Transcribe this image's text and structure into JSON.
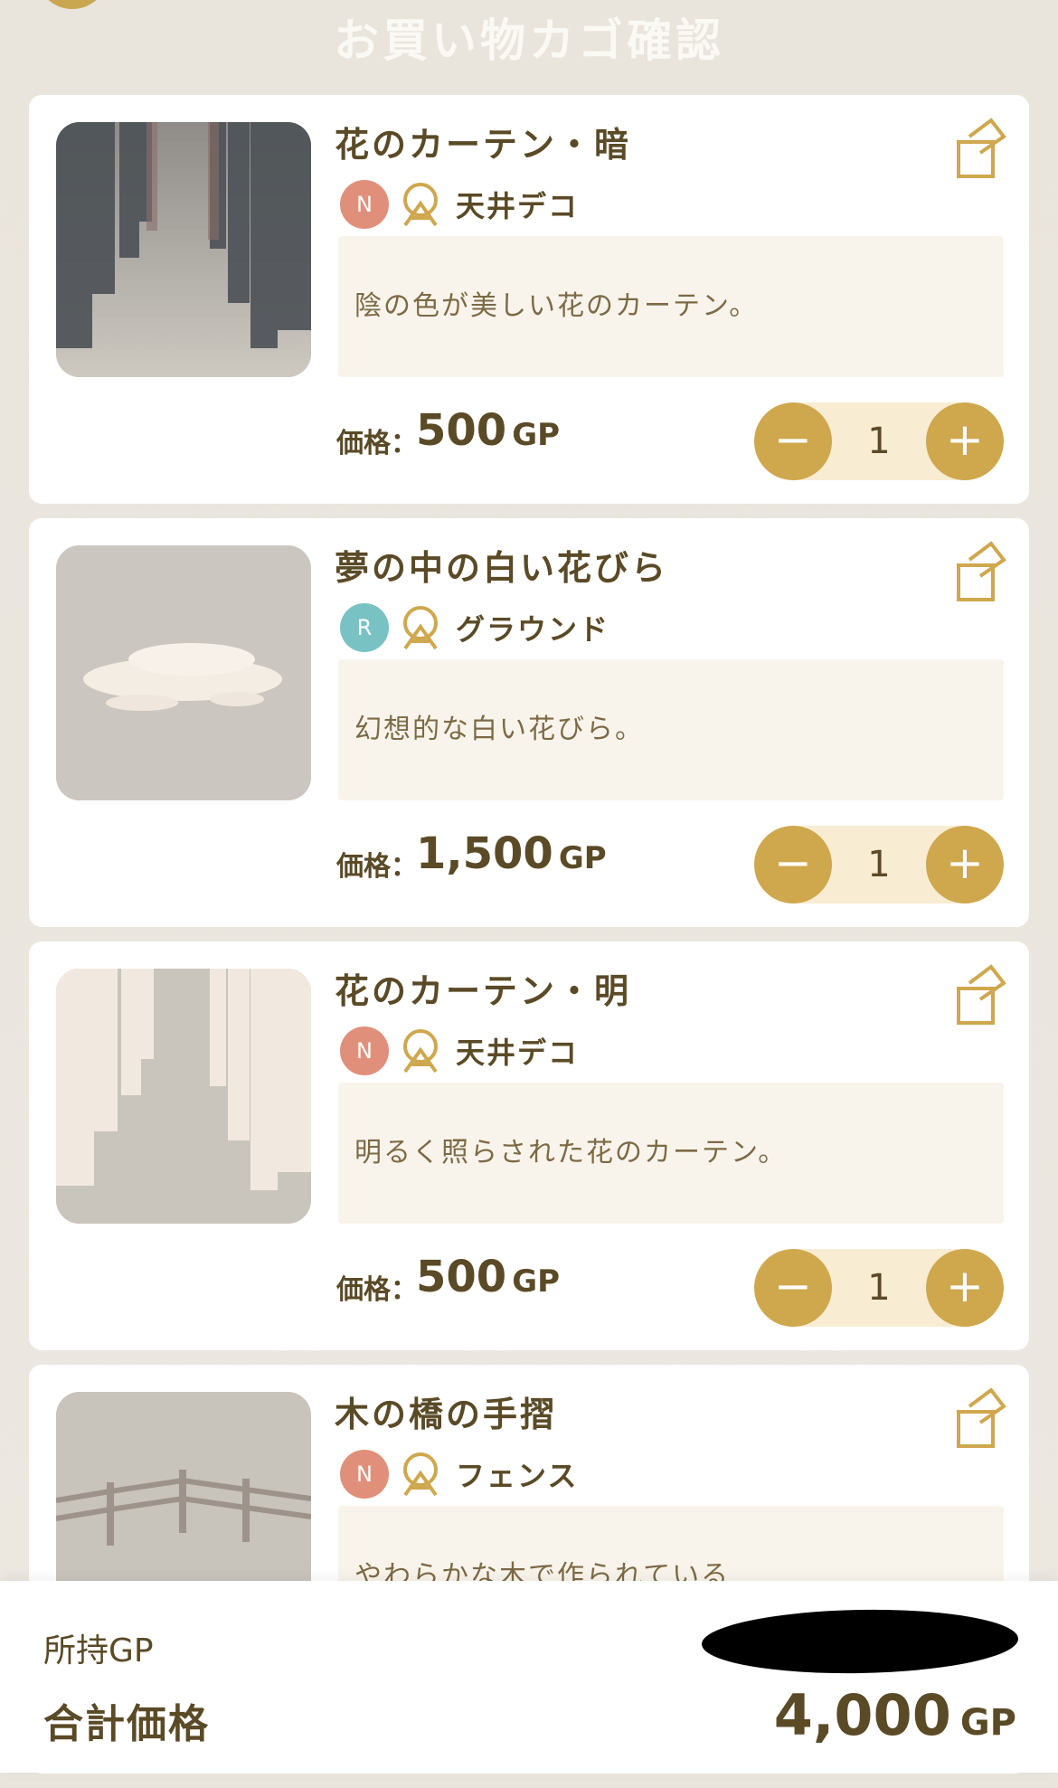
{
  "header": {
    "title": "お買い物カゴ確認"
  },
  "items": [
    {
      "name": "花のカーテン・暗",
      "rarity": "N",
      "rarity_color": "#e0907a",
      "category": "天井デコ",
      "description": "陰の色が美しい花のカーテン。",
      "price_label": "価格：",
      "price": "500",
      "currency": "GP",
      "quantity": "1",
      "thumbnail": "dark-flower-curtain"
    },
    {
      "name": "夢の中の白い花びら",
      "rarity": "R",
      "rarity_color": "#79c2c4",
      "category": "グラウンド",
      "description": "幻想的な白い花びら。",
      "price_label": "価格：",
      "price": "1,500",
      "currency": "GP",
      "quantity": "1",
      "thumbnail": "white-petals"
    },
    {
      "name": "花のカーテン・明",
      "rarity": "N",
      "rarity_color": "#e0907a",
      "category": "天井デコ",
      "description": "明るく照らされた花のカーテン。",
      "price_label": "価格：",
      "price": "500",
      "currency": "GP",
      "quantity": "1",
      "thumbnail": "light-flower-curtain"
    },
    {
      "name": "木の橋の手摺",
      "rarity": "N",
      "rarity_color": "#e0907a",
      "category": "フェンス",
      "description": "やわらかな木で作られている",
      "thumbnail": "wooden-bridge-railing"
    }
  ],
  "controls": {
    "minus": "−",
    "plus": "+"
  },
  "footer": {
    "owned_label": "所持GP",
    "total_label": "合計価格",
    "total_value": "4,000",
    "currency": "GP"
  },
  "colors": {
    "accent": "#cfa74d",
    "text": "#5a4a26",
    "qty_bg": "#f8ecd2",
    "desc_bg": "#f9f4eb"
  }
}
